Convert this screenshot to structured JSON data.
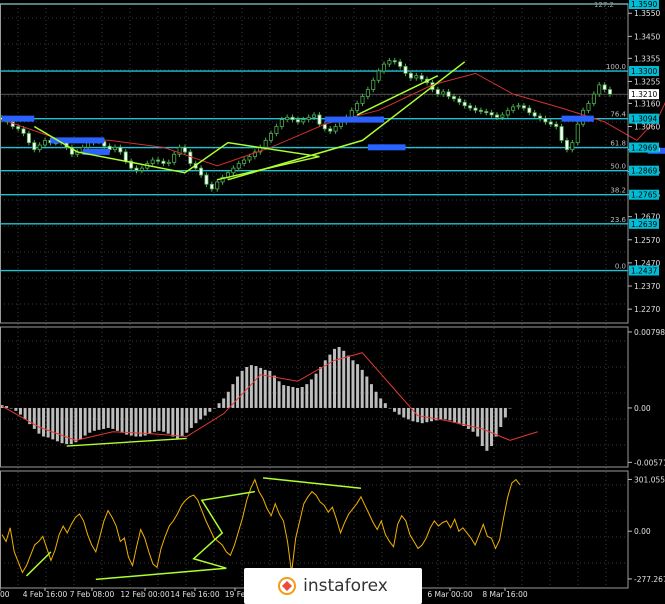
{
  "chart_data": [
    {
      "panel": "price",
      "type": "candlestick",
      "ylim": [
        1.221,
        1.359
      ],
      "y_ticks": [
        "1.3550",
        "1.3450",
        "1.3355",
        "1.3255",
        "1.3160",
        "1.3060",
        "1.2960",
        "1.2865",
        "1.2765",
        "1.2670",
        "1.2570",
        "1.2470",
        "1.2370",
        "1.2270"
      ],
      "fib_levels": [
        {
          "label": "100.0",
          "value": 1.33,
          "tag": "1.3300"
        },
        {
          "label": "76.4",
          "value": 1.3094,
          "tag": "1.3094"
        },
        {
          "label": "61.8",
          "value": 1.2969,
          "tag": "1.2969"
        },
        {
          "label": "50.0",
          "value": 1.2869,
          "tag": "1.2869"
        },
        {
          "label": "38.2",
          "value": 1.2765,
          "tag": "1.2765"
        },
        {
          "label": "23.6",
          "value": 1.2639,
          "tag": "1.2639"
        },
        {
          "label": "0.0",
          "value": 1.2437,
          "tag": "1.2437"
        }
      ],
      "top_level": {
        "label": "127.2",
        "value": 1.359,
        "tag": "1.3590"
      },
      "current_price": "1.3210",
      "close_series": [
        1.309,
        1.308,
        1.306,
        1.305,
        1.303,
        1.299,
        1.296,
        1.298,
        1.3,
        1.299,
        1.299,
        1.3,
        1.297,
        1.294,
        1.295,
        1.297,
        1.299,
        1.3,
        1.2995,
        1.2975,
        1.296,
        1.297,
        1.295,
        1.291,
        1.288,
        1.287,
        1.288,
        1.29,
        1.2915,
        1.291,
        1.29,
        1.2905,
        1.294,
        1.297,
        1.295,
        1.29,
        1.288,
        1.285,
        1.281,
        1.279,
        1.282,
        1.284,
        1.286,
        1.288,
        1.29,
        1.2915,
        1.293,
        1.295,
        1.297,
        1.3,
        1.303,
        1.306,
        1.309,
        1.31,
        1.309,
        1.308,
        1.309,
        1.31,
        1.311,
        1.307,
        1.305,
        1.304,
        1.306,
        1.308,
        1.31,
        1.313,
        1.316,
        1.319,
        1.322,
        1.326,
        1.33,
        1.333,
        1.3345,
        1.334,
        1.332,
        1.329,
        1.327,
        1.328,
        1.3265,
        1.325,
        1.322,
        1.32,
        1.321,
        1.319,
        1.318,
        1.3165,
        1.315,
        1.314,
        1.313,
        1.3125,
        1.312,
        1.311,
        1.31,
        1.311,
        1.313,
        1.3145,
        1.315,
        1.314,
        1.312,
        1.3105,
        1.3095,
        1.308,
        1.307,
        1.306,
        1.3,
        1.296,
        1.299,
        1.307,
        1.313,
        1.316,
        1.32,
        1.324,
        1.322,
        1.32
      ],
      "overlay_lines": [
        {
          "color": "#adff2f",
          "points": [
            [
              6,
              1.306
            ],
            [
              14,
              1.295
            ],
            [
              34,
              1.286
            ],
            [
              42,
              1.299
            ],
            [
              59,
              1.293
            ],
            [
              40,
              1.283
            ]
          ]
        },
        {
          "color": "#adff2f",
          "points": [
            [
              42,
              1.283
            ],
            [
              67,
              1.3
            ],
            [
              86,
              1.334
            ]
          ]
        },
        {
          "color": "#adff2f",
          "points": [
            [
              66,
              1.311
            ],
            [
              81,
              1.328
            ]
          ]
        }
      ],
      "moving_average": [
        [
          0,
          1.309
        ],
        [
          10,
          1.301
        ],
        [
          20,
          1.3
        ],
        [
          30,
          1.297
        ],
        [
          40,
          1.289
        ],
        [
          50,
          1.297
        ],
        [
          60,
          1.307
        ],
        [
          70,
          1.313
        ],
        [
          80,
          1.324
        ],
        [
          88,
          1.329
        ],
        [
          95,
          1.32
        ],
        [
          104,
          1.314
        ],
        [
          112,
          1.308
        ],
        [
          118,
          1.3
        ],
        [
          122,
          1.31
        ],
        [
          126,
          1.33
        ]
      ],
      "support_marks": [
        {
          "x0": 0,
          "x1": 6,
          "y": 1.3094
        },
        {
          "x0": 9,
          "x1": 19,
          "y": 1.3
        },
        {
          "x0": 15,
          "x1": 20,
          "y": 1.295
        },
        {
          "x0": 60,
          "x1": 71,
          "y": 1.309
        },
        {
          "x0": 68,
          "x1": 75,
          "y": 1.297
        },
        {
          "x0": 104,
          "x1": 110,
          "y": 1.3094
        },
        {
          "x0": 120,
          "x1": 125,
          "y": 1.2955
        }
      ]
    },
    {
      "panel": "macd",
      "type": "bar",
      "ylim": [
        -0.0062,
        0.0085
      ],
      "y_ticks": [
        "0.00798",
        "0.00",
        "-0.00571"
      ],
      "values": [
        0.0003,
        0.0002,
        0.0,
        -0.0003,
        -0.0007,
        -0.0012,
        -0.0017,
        -0.0022,
        -0.0027,
        -0.003,
        -0.0031,
        -0.0033,
        -0.0035,
        -0.0037,
        -0.0038,
        -0.0038,
        -0.0036,
        -0.0033,
        -0.0029,
        -0.0026,
        -0.0024,
        -0.0023,
        -0.0022,
        -0.0021,
        -0.0022,
        -0.0024,
        -0.0026,
        -0.0028,
        -0.0029,
        -0.003,
        -0.003,
        -0.0029,
        -0.0027,
        -0.0025,
        -0.0024,
        -0.0025,
        -0.0027,
        -0.003,
        -0.0032,
        -0.003,
        -0.0026,
        -0.0021,
        -0.0016,
        -0.0012,
        -0.0008,
        -0.0004,
        0.0,
        0.0005,
        0.001,
        0.0017,
        0.0025,
        0.0033,
        0.0039,
        0.0043,
        0.0045,
        0.0044,
        0.0042,
        0.004,
        0.0039,
        0.0034,
        0.0028,
        0.0024,
        0.0023,
        0.0022,
        0.0021,
        0.0022,
        0.0025,
        0.003,
        0.0036,
        0.0043,
        0.005,
        0.0056,
        0.0062,
        0.0064,
        0.006,
        0.0055,
        0.005,
        0.0046,
        0.004,
        0.0033,
        0.0025,
        0.0017,
        0.001,
        0.0005,
        0.0,
        -0.0004,
        -0.0007,
        -0.001,
        -0.0012,
        -0.0014,
        -0.0015,
        -0.0016,
        -0.0015,
        -0.0014,
        -0.0013,
        -0.0012,
        -0.0012,
        -0.0013,
        -0.0015,
        -0.0017,
        -0.0019,
        -0.0022,
        -0.0025,
        -0.003,
        -0.004,
        -0.0045,
        -0.004,
        -0.003,
        -0.002,
        -0.001,
        0.0
      ],
      "signal": [
        [
          0,
          0.0002
        ],
        [
          8,
          -0.002
        ],
        [
          16,
          -0.0034
        ],
        [
          24,
          -0.0025
        ],
        [
          32,
          -0.0027
        ],
        [
          40,
          -0.003
        ],
        [
          48,
          -0.0006
        ],
        [
          56,
          0.0035
        ],
        [
          64,
          0.0028
        ],
        [
          72,
          0.005
        ],
        [
          78,
          0.0058
        ],
        [
          84,
          0.0025
        ],
        [
          90,
          -0.0008
        ],
        [
          96,
          -0.0013
        ],
        [
          104,
          -0.0022
        ],
        [
          110,
          -0.0034
        ],
        [
          116,
          -0.0025
        ]
      ],
      "divergence_line": {
        "color": "#adff2f",
        "points": [
          [
            14,
            -0.004
          ],
          [
            40,
            -0.0032
          ]
        ]
      }
    },
    {
      "panel": "cci",
      "type": "line",
      "ylim": [
        -330,
        350
      ],
      "y_ticks": [
        "301.0559",
        "0.00",
        "-277.2678"
      ],
      "values": [
        -20,
        -60,
        20,
        -120,
        -180,
        -240,
        -200,
        -140,
        -80,
        -60,
        -30,
        -100,
        -170,
        -110,
        -20,
        30,
        -10,
        40,
        80,
        100,
        60,
        -20,
        -80,
        -120,
        -30,
        60,
        120,
        80,
        30,
        -60,
        -40,
        -150,
        -200,
        -90,
        10,
        -40,
        -120,
        -190,
        -210,
        -100,
        -30,
        30,
        60,
        100,
        150,
        180,
        200,
        210,
        180,
        120,
        60,
        10,
        -40,
        -60,
        -80,
        -120,
        -140,
        -80,
        0,
        80,
        180,
        250,
        300,
        230,
        190,
        130,
        90,
        160,
        100,
        60,
        -60,
        -240,
        -40,
        60,
        160,
        200,
        230,
        210,
        170,
        150,
        110,
        140,
        70,
        -10,
        50,
        100,
        130,
        160,
        200,
        150,
        100,
        50,
        10,
        60,
        -20,
        -60,
        -90,
        40,
        90,
        60,
        -20,
        -60,
        -100,
        -80,
        -40,
        20,
        60,
        30,
        50,
        60,
        20,
        70,
        0,
        20,
        -10,
        -40,
        -80,
        -20,
        40,
        -30,
        -40,
        -100,
        -50,
        80,
        200,
        280,
        300,
        270
      ],
      "overlay_lines": [
        {
          "color": "#adff2f",
          "points": [
            [
              6,
              -260
            ],
            [
              12,
              -120
            ]
          ]
        },
        {
          "color": "#adff2f",
          "points": [
            [
              23,
              -280
            ],
            [
              55,
              -215
            ],
            [
              47,
              -160
            ],
            [
              54,
              -10
            ],
            [
              49,
              180
            ],
            [
              62,
              230
            ]
          ]
        },
        {
          "color": "#adff2f",
          "points": [
            [
              64,
              310
            ],
            [
              88,
              250
            ]
          ]
        }
      ]
    }
  ],
  "x_axis_labels": [
    "00",
    "4 Feb 16:00",
    "7 Feb 08:00",
    "12 Feb 00:00",
    "14 Feb 16:00",
    "19 Fe",
    "6 Mar 00:00",
    "8 Mar 16:00"
  ],
  "watermark_text": "instaforex"
}
